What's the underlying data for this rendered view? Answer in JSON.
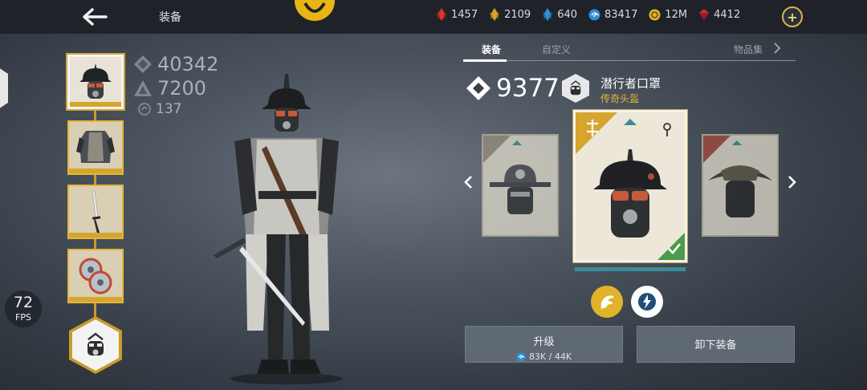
{
  "header": {
    "title": "装备",
    "back_icon": "back-arrow-icon",
    "emblem_icon": "clan-emblem-icon"
  },
  "currencies": [
    {
      "icon": "red-crystal-icon",
      "color": "#d9342b",
      "value": "1457"
    },
    {
      "icon": "gold-crystal-icon",
      "color": "#d9a227",
      "value": "2109"
    },
    {
      "icon": "blue-crystal-icon",
      "color": "#2f8ed6",
      "value": "640"
    },
    {
      "icon": "coin-swirl-icon",
      "color": "#2f8ed6",
      "value": "83417"
    },
    {
      "icon": "gold-coin-icon",
      "color": "#e0b32a",
      "value": "12M"
    },
    {
      "icon": "ruby-gem-icon",
      "color": "#c8302a",
      "value": "4412"
    }
  ],
  "character_stats": {
    "power": "40342",
    "armor": "7200",
    "level": "137"
  },
  "fps": {
    "value": "72",
    "label": "FPS"
  },
  "tabs": [
    {
      "label": "装备",
      "active": true
    },
    {
      "label": "自定义",
      "active": false
    },
    {
      "label": "物品集",
      "active": false
    }
  ],
  "item": {
    "power": "9377",
    "name": "潜行者口罩",
    "rarity": "传奇头盔"
  },
  "buttons": {
    "upgrade_label": "升级",
    "upgrade_cost": "83K / 44K",
    "unequip_label": "卸下装备"
  },
  "colors": {
    "gold": "#e0b32a",
    "legend": "#e6b531",
    "equipped": "#4c9a4a"
  }
}
